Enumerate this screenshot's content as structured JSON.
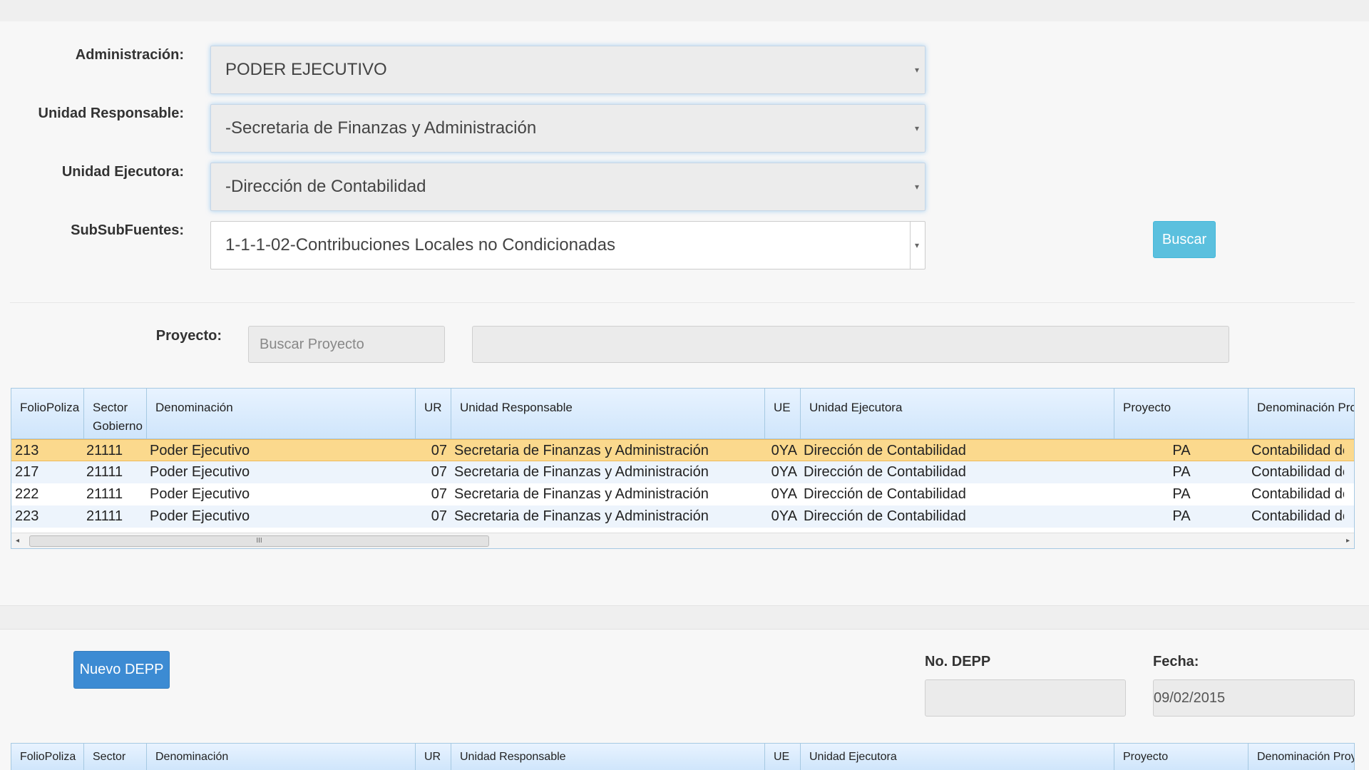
{
  "filters": {
    "administracion": {
      "label": "Administración:",
      "value": "PODER EJECUTIVO"
    },
    "unidad_responsable": {
      "label": "Unidad Responsable:",
      "value": "-Secretaria de Finanzas y Administración"
    },
    "unidad_ejecutora": {
      "label": "Unidad Ejecutora:",
      "value": "-Dirección de Contabilidad"
    },
    "subsubfuentes": {
      "label": "SubSubFuentes:",
      "value": "1-1-1-02-Contribuciones Locales no Condicionadas"
    },
    "buscar_label": "Buscar"
  },
  "proyecto": {
    "label": "Proyecto:",
    "search_placeholder": "Buscar Proyecto",
    "description_value": ""
  },
  "grid1": {
    "headers": {
      "folio": "FolioPoliza",
      "sector": "Sector Gobierno",
      "denominacion": "Denominación",
      "ur": "UR",
      "unidad_responsable": "Unidad Responsable",
      "ue": "UE",
      "unidad_ejecutora": "Unidad Ejecutora",
      "proyecto": "Proyecto",
      "denominacion_proyecto": "Denominación Proy"
    },
    "rows": [
      {
        "folio": "213",
        "sector": "21111",
        "denominacion": "Poder Ejecutivo",
        "ur": "07",
        "unidad_responsable": "Secretaria de Finanzas y Administración",
        "ue": "0YA",
        "unidad_ejecutora": "Dirección de Contabilidad",
        "proyecto": "PA",
        "denominacion_proyecto": "Contabilidad de la H"
      },
      {
        "folio": "217",
        "sector": "21111",
        "denominacion": "Poder Ejecutivo",
        "ur": "07",
        "unidad_responsable": "Secretaria de Finanzas y Administración",
        "ue": "0YA",
        "unidad_ejecutora": "Dirección de Contabilidad",
        "proyecto": "PA",
        "denominacion_proyecto": "Contabilidad de la H"
      },
      {
        "folio": "222",
        "sector": "21111",
        "denominacion": "Poder Ejecutivo",
        "ur": "07",
        "unidad_responsable": "Secretaria de Finanzas y Administración",
        "ue": "0YA",
        "unidad_ejecutora": "Dirección de Contabilidad",
        "proyecto": "PA",
        "denominacion_proyecto": "Contabilidad de la H"
      },
      {
        "folio": "223",
        "sector": "21111",
        "denominacion": "Poder Ejecutivo",
        "ur": "07",
        "unidad_responsable": "Secretaria de Finanzas y Administración",
        "ue": "0YA",
        "unidad_ejecutora": "Dirección de Contabilidad",
        "proyecto": "PA",
        "denominacion_proyecto": "Contabilidad de la H"
      }
    ],
    "scroll_grip": "III"
  },
  "depp": {
    "nuevo_label": "Nuevo DEPP",
    "no_depp_label": "No. DEPP",
    "no_depp_value": "",
    "fecha_label": "Fecha:",
    "fecha_value": "09/02/2015"
  },
  "grid2": {
    "headers": {
      "folio": "FolioPoliza",
      "sector": "Sector",
      "denominacion": "Denominación",
      "ur": "UR",
      "unidad_responsable": "Unidad Responsable",
      "ue": "UE",
      "unidad_ejecutora": "Unidad Ejecutora",
      "proyecto": "Proyecto",
      "denominacion_proyecto": "Denominación Proyecto"
    }
  },
  "icons": {
    "arrow_down": "▾",
    "arrow_left": "◂",
    "arrow_right": "▸"
  },
  "colors": {
    "info": "#5bc0de",
    "primary": "#3c8bd3",
    "selected_row": "#fbd98d",
    "grid_header": "#cfe5fb"
  }
}
